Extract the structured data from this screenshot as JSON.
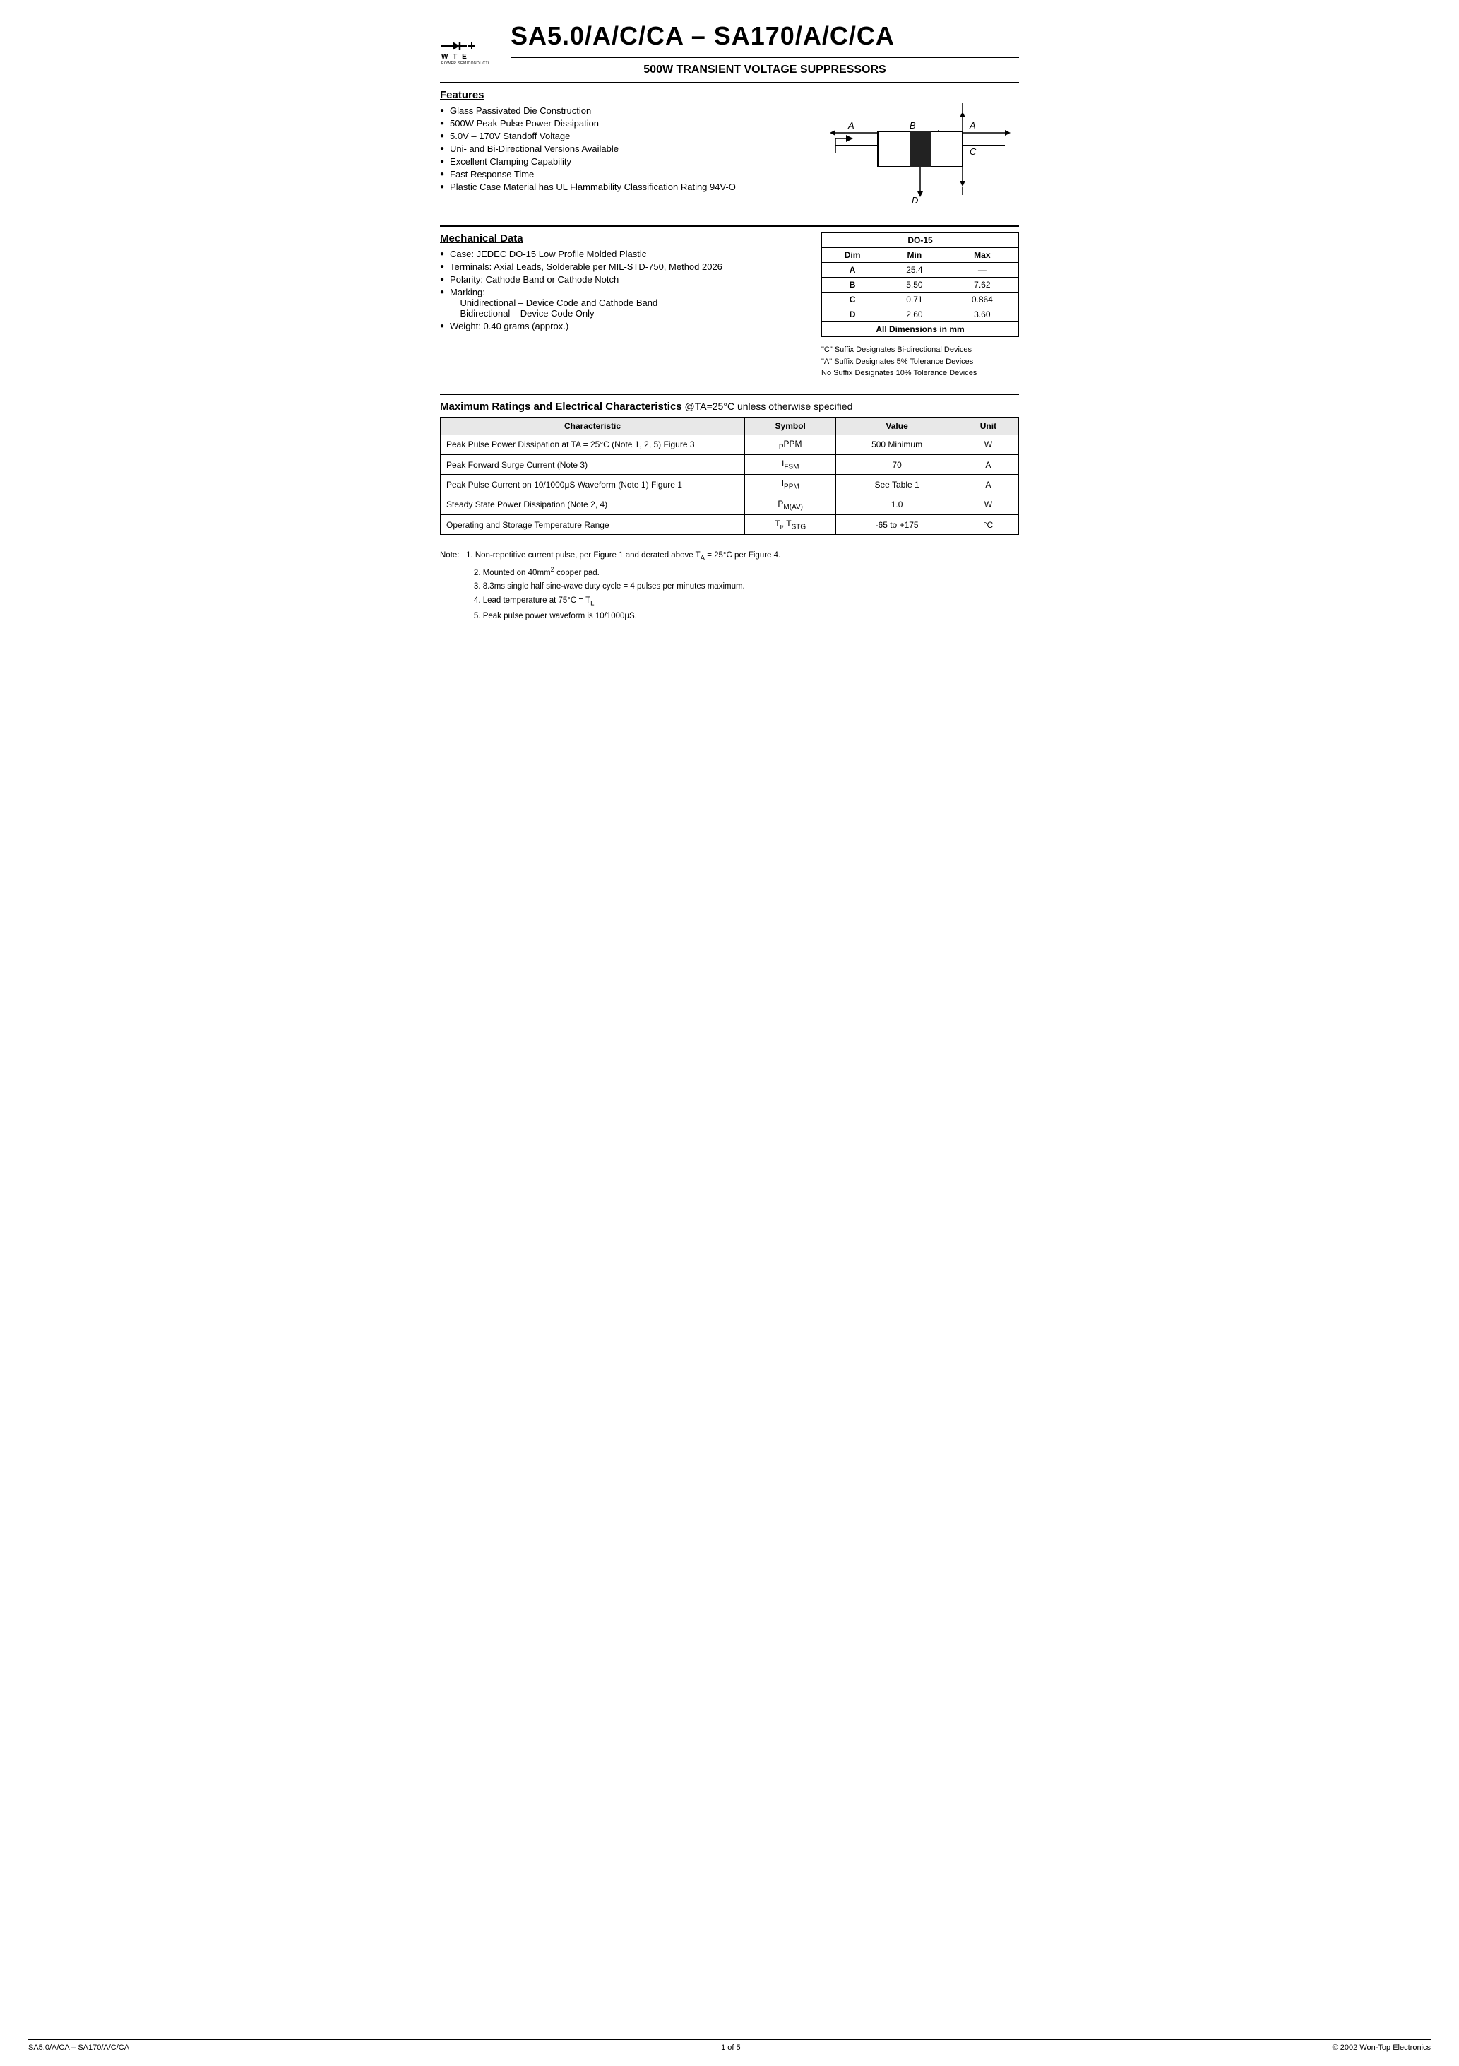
{
  "header": {
    "main_title": "SA5.0/A/C/CA – SA170/A/C/CA",
    "sub_title": "500W TRANSIENT VOLTAGE SUPPRESSORS",
    "logo_wte": "WTE",
    "logo_sub": "POWER SEMICONDUCTORS"
  },
  "features": {
    "title": "Features",
    "items": [
      "Glass Passivated Die Construction",
      "500W Peak Pulse Power Dissipation",
      "5.0V – 170V Standoff Voltage",
      "Uni- and Bi-Directional Versions Available",
      "Excellent Clamping Capability",
      "Fast Response Time",
      "Plastic Case Material has UL Flammability Classification Rating 94V-O"
    ]
  },
  "mechanical": {
    "title": "Mechanical Data",
    "items": [
      "Case: JEDEC DO-15 Low Profile Molded Plastic",
      "Terminals: Axial Leads, Solderable per MIL-STD-750, Method 2026",
      "Polarity: Cathode Band or Cathode Notch",
      "Marking:",
      "Unidirectional – Device Code and Cathode Band",
      "Bidirectional – Device Code Only",
      "Weight: 0.40 grams (approx.)"
    ]
  },
  "do15_table": {
    "title": "DO-15",
    "headers": [
      "Dim",
      "Min",
      "Max"
    ],
    "rows": [
      [
        "A",
        "25.4",
        "—"
      ],
      [
        "B",
        "5.50",
        "7.62"
      ],
      [
        "C",
        "0.71",
        "0.864"
      ],
      [
        "D",
        "2.60",
        "3.60"
      ]
    ],
    "footer": "All Dimensions in mm"
  },
  "suffix_notes": [
    "\"C\" Suffix Designates Bi-directional Devices",
    "\"A\" Suffix Designates 5% Tolerance Devices",
    "No Suffix Designates 10% Tolerance Devices"
  ],
  "ratings": {
    "title": "Maximum Ratings and Electrical Characteristics",
    "condition": "@TA=25°C unless otherwise specified",
    "headers": [
      "Characteristic",
      "Symbol",
      "Value",
      "Unit"
    ],
    "rows": [
      {
        "characteristic": "Peak Pulse Power Dissipation at TA = 25°C (Note 1, 2, 5) Figure 3",
        "symbol": "PPPM",
        "value": "500 Minimum",
        "unit": "W"
      },
      {
        "characteristic": "Peak Forward Surge Current (Note 3)",
        "symbol": "IFSM",
        "value": "70",
        "unit": "A"
      },
      {
        "characteristic": "Peak Pulse Current on 10/1000μS Waveform (Note 1) Figure 1",
        "symbol": "IPPM",
        "value": "See Table 1",
        "unit": "A"
      },
      {
        "characteristic": "Steady State Power Dissipation (Note 2, 4)",
        "symbol": "PM(AV)",
        "value": "1.0",
        "unit": "W"
      },
      {
        "characteristic": "Operating and Storage Temperature Range",
        "symbol": "Ti, TSTG",
        "value": "-65 to +175",
        "unit": "°C"
      }
    ]
  },
  "notes": {
    "intro": "Note:",
    "items": [
      "1. Non-repetitive current pulse, per Figure 1 and derated above TA = 25°C per Figure 4.",
      "2. Mounted on 40mm² copper pad.",
      "3. 8.3ms single half sine-wave duty cycle = 4 pulses per minutes maximum.",
      "4. Lead temperature at 75°C = TL",
      "5. Peak pulse power waveform is 10/1000μS."
    ]
  },
  "footer": {
    "left": "SA5.0/A/CA – SA170/A/C/CA",
    "center": "1 of 5",
    "right": "© 2002 Won-Top Electronics"
  }
}
